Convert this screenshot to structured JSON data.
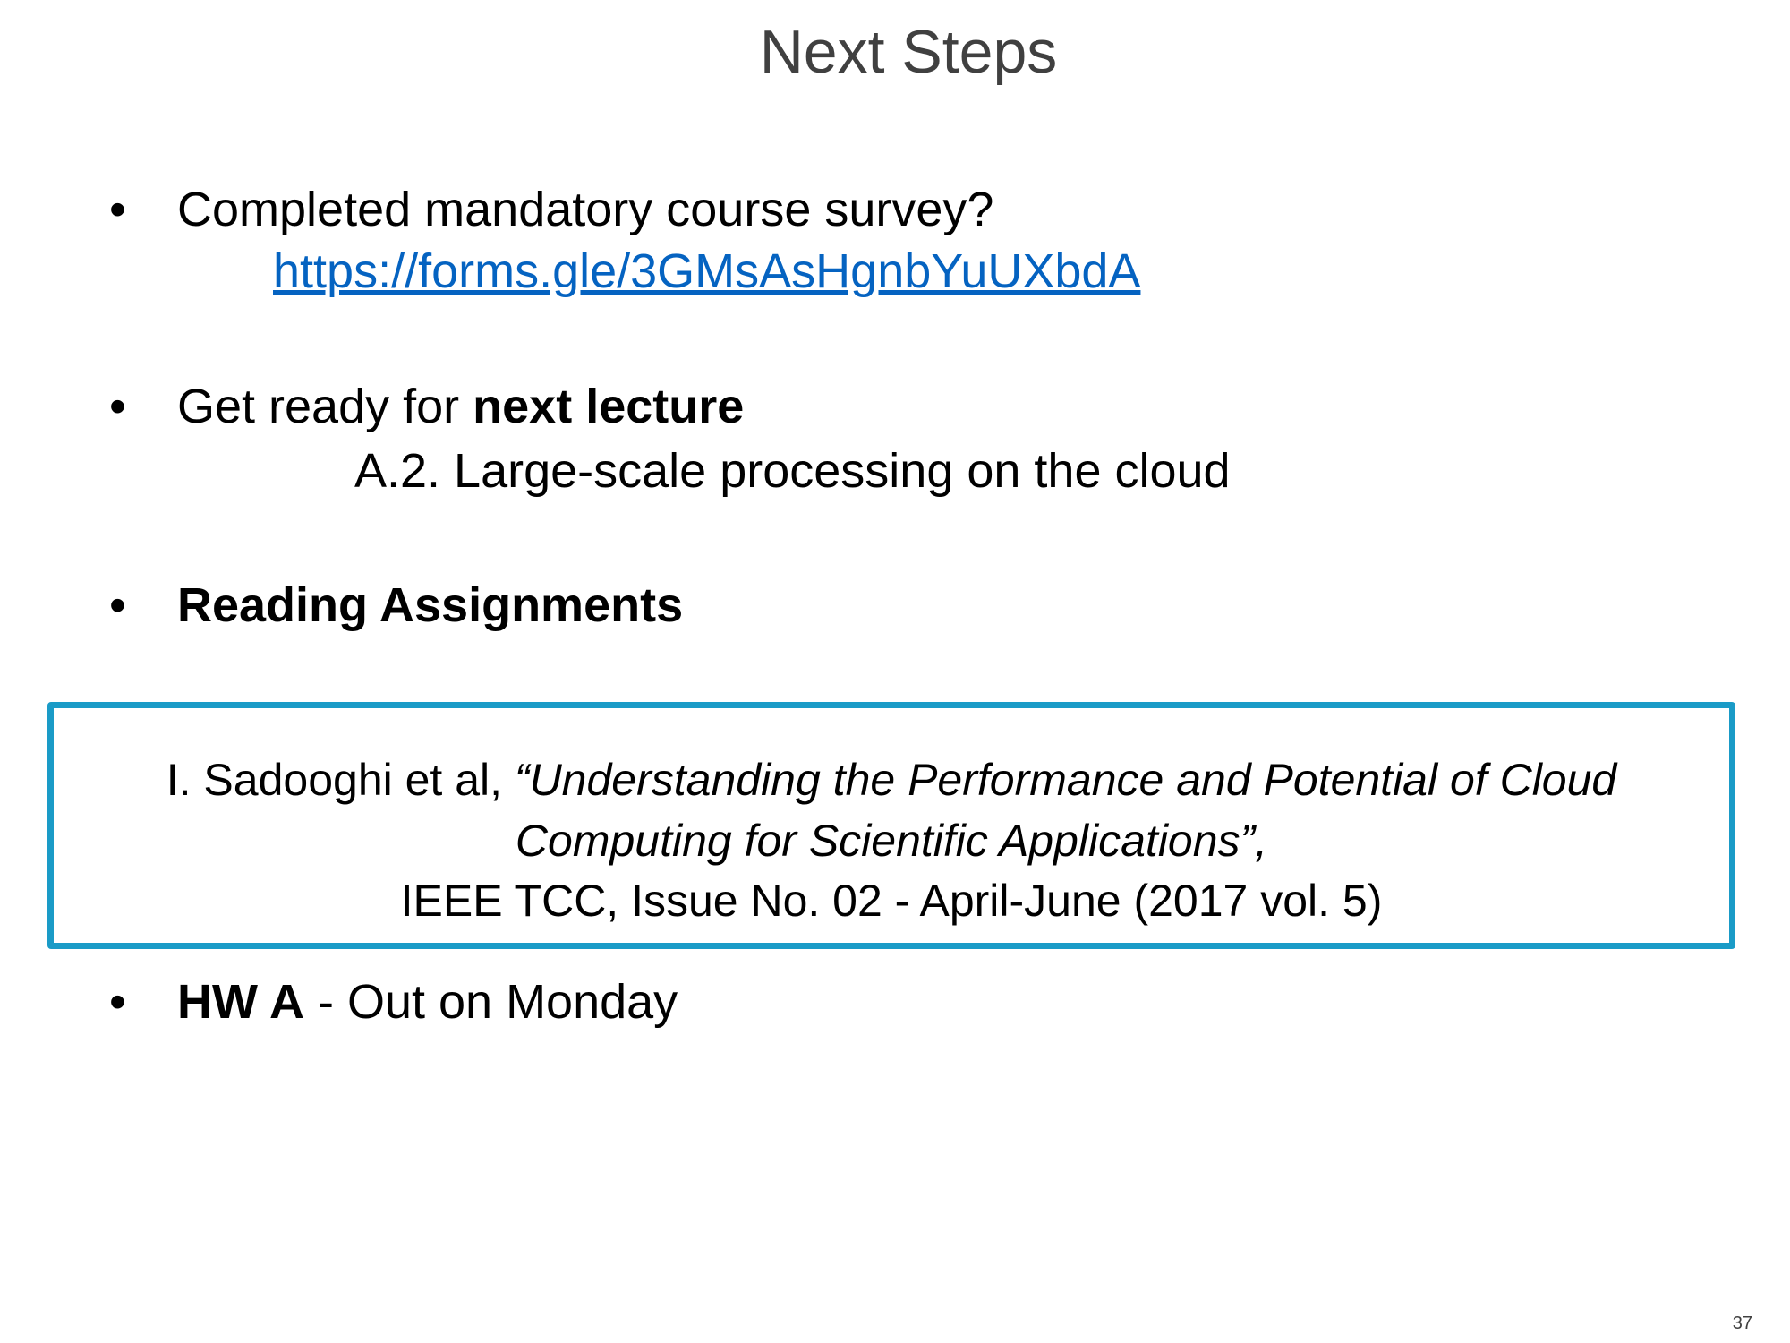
{
  "title": "Next Steps",
  "bullets": {
    "survey": {
      "marker": "•",
      "text": "Completed mandatory course survey?",
      "link": "https://forms.gle/3GMsAsHgnbYuUXbdA"
    },
    "lecture": {
      "marker": "•",
      "prefix": "Get ready for ",
      "bold": "next lecture",
      "subline": "A.2. Large-scale processing on the cloud"
    },
    "reading": {
      "marker": "•",
      "bold": "Reading Assignments"
    },
    "homework": {
      "marker": "•",
      "bold": "HW A",
      "suffix": " - Out on Monday"
    }
  },
  "reference": {
    "authors": "I. Sadooghi et al, ",
    "title_line1": "“Understanding the Performance and Potential of Cloud",
    "title_line2": "Computing for Scientific Applications”,",
    "venue": "IEEE TCC, Issue No. 02 - April-June (2017 vol. 5)",
    "border_color": "#1a9bc7"
  },
  "link_color": "#0563c1",
  "page_number": "37"
}
